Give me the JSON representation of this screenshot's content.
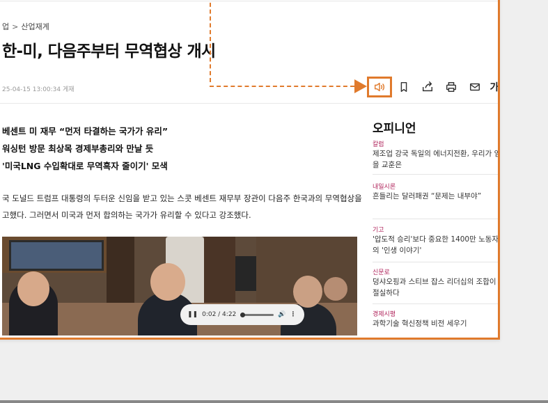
{
  "breadcrumb": {
    "first": "업",
    "sep": ">",
    "second": "산업재계"
  },
  "headline": "한-미, 다음주부터 무역협상 개시",
  "dateline": "25-04-15 13:00:34 게재",
  "toolbar": {
    "icons": [
      "speaker-icon",
      "bookmark-icon",
      "share-icon",
      "print-icon",
      "mail-icon"
    ],
    "font_label": "가"
  },
  "subheads": [
    "베센트 미 재무 “먼저 타결하는 국가가 유리”",
    "워싱턴 방문 최상목 경제부총리와 만날 듯",
    "'미국LNG 수입확대로 무역흑자 줄이기' 모색"
  ],
  "body": {
    "line1": "국 도널드 트럼프 대통령의 두터운 신임을 받고 있는 스콧 베센트 재무부 장관이 다음주 한국과의 무역협상을",
    "line2": "고했다. 그러면서 미국과 먼저 합의하는 국가가 유리할 수 있다고 강조했다."
  },
  "player": {
    "pause": "❚❚",
    "time": "0:02 / 4:22",
    "volume": "🔊",
    "more": "⋮"
  },
  "sidebar": {
    "title": "오피니언",
    "items": [
      {
        "category": "칼럼",
        "text": "제조업 강국 독일의 에너지전환, 우리가 얻을 교훈은"
      },
      {
        "category": "내일시론",
        "text": "흔들리는 달러패권 “문제는 내부야”"
      },
      {
        "category": "기고",
        "text": "'압도적 승리'보다 중요한 1400만 노동자의 '인생 이야기'"
      },
      {
        "category": "신문로",
        "text": "덩샤오핑과 스티브 잡스 리더십의 조합이 절실하다"
      },
      {
        "category": "경제시평",
        "text": "과학기술 혁신정책 비전 세우기"
      }
    ]
  },
  "colors": {
    "highlight": "#e07a2c",
    "category": "#b0245b"
  }
}
